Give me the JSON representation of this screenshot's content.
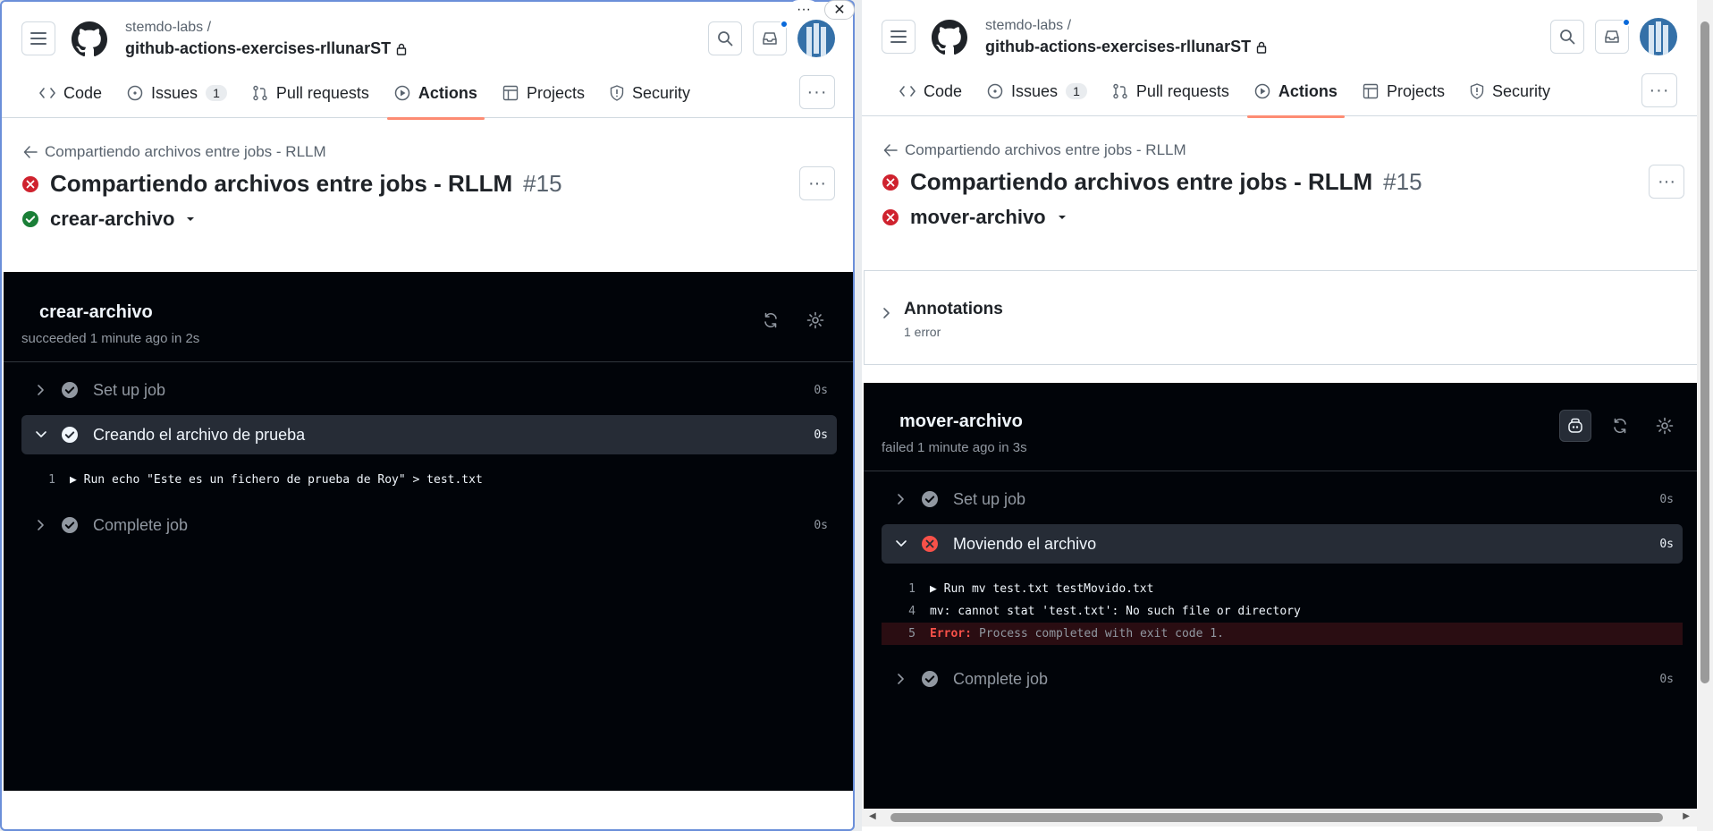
{
  "header": {
    "org": "stemdo-labs /",
    "repo": "github-actions-exercises-rllunarST",
    "tabs": [
      {
        "label": "Code"
      },
      {
        "label": "Issues",
        "count": "1"
      },
      {
        "label": "Pull requests"
      },
      {
        "label": "Actions"
      },
      {
        "label": "Projects"
      },
      {
        "label": "Security"
      }
    ]
  },
  "left": {
    "breadcrumb": "Compartiendo archivos entre jobs - RLLM",
    "run_title": "Compartiendo archivos entre jobs - RLLM",
    "run_number": "#15",
    "job_selector": "crear-archivo",
    "log": {
      "job_name": "crear-archivo",
      "job_status": "succeeded 1 minute ago in 2s",
      "steps": [
        {
          "name": "Set up job",
          "duration": "0s",
          "status": "success"
        },
        {
          "name": "Creando el archivo de prueba",
          "duration": "0s",
          "status": "success",
          "expanded": true
        },
        {
          "name": "Complete job",
          "duration": "0s",
          "status": "success"
        }
      ],
      "lines": [
        {
          "no": "1",
          "text": "▶ Run echo \"Este es un fichero de prueba de Roy\" > test.txt"
        }
      ]
    }
  },
  "right": {
    "breadcrumb": "Compartiendo archivos entre jobs - RLLM",
    "run_title": "Compartiendo archivos entre jobs - RLLM",
    "run_number": "#15",
    "job_selector": "mover-archivo",
    "annotations": {
      "title": "Annotations",
      "subtitle": "1 error"
    },
    "log": {
      "job_name": "mover-archivo",
      "job_status": "failed 1 minute ago in 3s",
      "steps": [
        {
          "name": "Set up job",
          "duration": "0s",
          "status": "success"
        },
        {
          "name": "Moviendo el archivo",
          "duration": "0s",
          "status": "failure",
          "expanded": true
        },
        {
          "name": "Complete job",
          "duration": "0s",
          "status": "success"
        }
      ],
      "lines": [
        {
          "no": "1",
          "text": "▶ Run mv test.txt testMovido.txt"
        },
        {
          "no": "4",
          "text": "mv: cannot stat 'test.txt': No such file or directory"
        },
        {
          "no": "5",
          "label": "Error:",
          "text": "Process completed with exit code 1."
        }
      ]
    }
  },
  "colors": {
    "success": "#1a7f37",
    "failure": "#cf222e",
    "accent": "#fd8c73",
    "log_bg": "#010409"
  }
}
